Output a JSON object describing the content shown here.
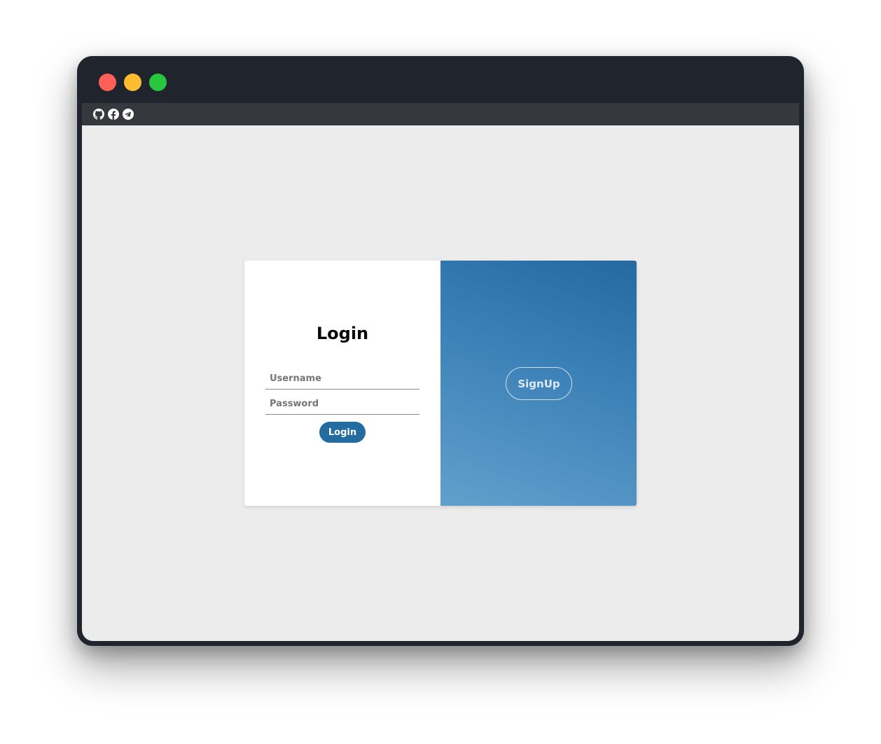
{
  "window": {
    "controls": {
      "close_color": "#fe5f57",
      "minimize_color": "#febc2e",
      "maximize_color": "#27c840"
    }
  },
  "toolbar": {
    "icons": [
      "github-icon",
      "facebook-icon",
      "telegram-icon"
    ]
  },
  "login_panel": {
    "title": "Login",
    "username_placeholder": "Username",
    "password_placeholder": "Password",
    "submit_label": "Login",
    "accent_color": "#246ba0"
  },
  "signup_panel": {
    "button_label": "SignUp",
    "gradient_colors": [
      "#2569a1",
      "#62a0cc"
    ]
  }
}
